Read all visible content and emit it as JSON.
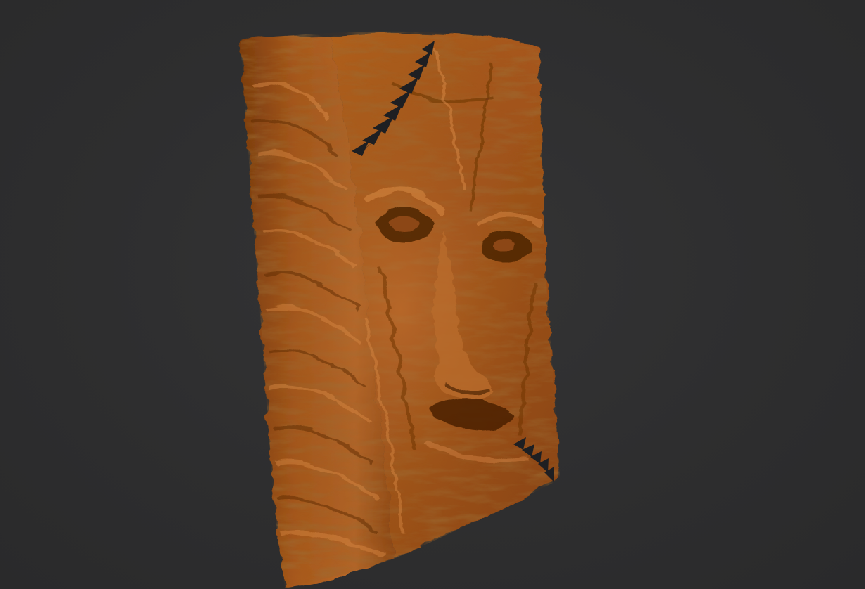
{
  "viewport": {
    "background_color": "#2d2d2e"
  },
  "model": {
    "subject": "sculpted-face-book",
    "material_color": "#b0601f",
    "shadow_color": "#5a2c08",
    "highlight_color": "#d98a45",
    "teeth_color": "#1e1f22"
  }
}
